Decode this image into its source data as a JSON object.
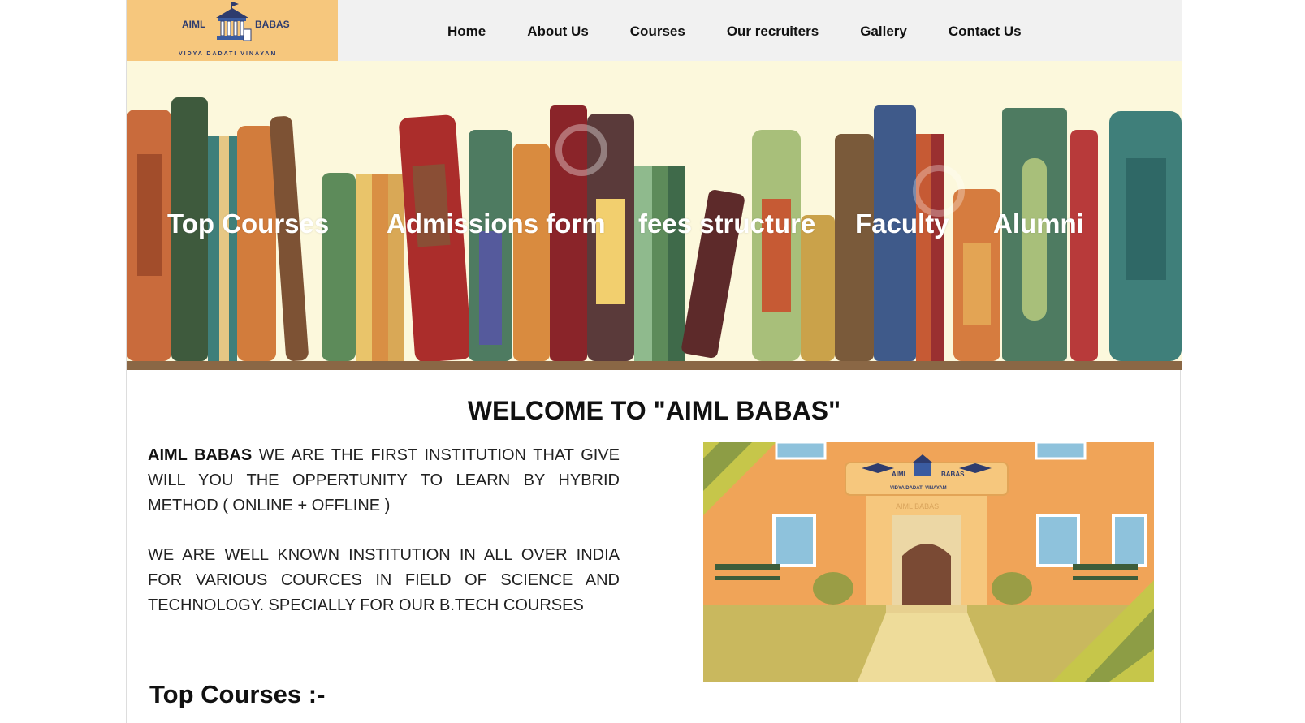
{
  "logo": {
    "left_text": "AIML",
    "right_text": "BABAS",
    "tagline": "VIDYA DADATI VINAYAM"
  },
  "nav": {
    "items": [
      {
        "label": "Home"
      },
      {
        "label": "About Us"
      },
      {
        "label": "Courses"
      },
      {
        "label": "Our recruiters"
      },
      {
        "label": "Gallery"
      },
      {
        "label": "Contact Us"
      }
    ]
  },
  "hero": {
    "links": [
      {
        "label": "Top Courses"
      },
      {
        "label": "Admissions form"
      },
      {
        "label": "fees structure"
      },
      {
        "label": "Faculty"
      },
      {
        "label": "Alumni"
      }
    ]
  },
  "welcome": {
    "title": "WELCOME TO \"AIML BABAS\""
  },
  "intro": {
    "brand": "AIML BABAS",
    "para1_rest": " WE ARE THE FIRST INSTITUTION THAT GIVE WILL YOU THE OPPERTUNITY TO LEARN BY HYBRID METHOD ( ONLINE + OFFLINE )",
    "para2": "WE ARE WELL KNOWN INSTITUTION IN ALL OVER INDIA FOR VARIOUS COURCES IN FIELD OF SCIENCE AND TECHNOLOGY. SPECIALLY FOR OUR B.TECH COURSES"
  },
  "campus_image": {
    "sign_left": "AIML",
    "sign_right": "BABAS",
    "sign_tagline": "VIDYA DADATI VINAYAM",
    "building_label": "AIML BABAS"
  },
  "sections": {
    "top_courses_heading": "Top Courses :-"
  },
  "colors": {
    "header_bg": "#f1f1f1",
    "logo_bg": "#f6c77d",
    "hero_bg": "#fcf8dc",
    "shelf": "#8a6745"
  }
}
